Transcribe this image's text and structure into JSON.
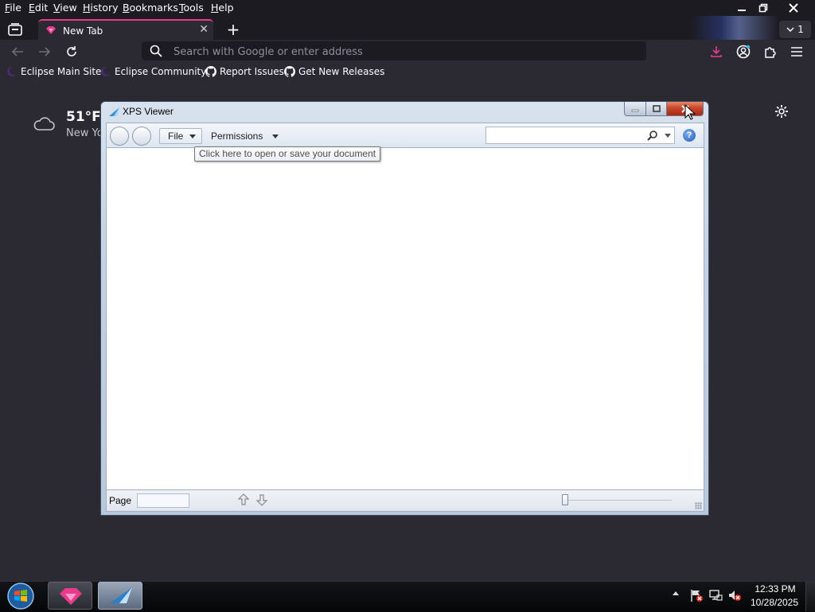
{
  "browser": {
    "menu": [
      "File",
      "Edit",
      "View",
      "History",
      "Bookmarks",
      "Tools",
      "Help"
    ],
    "tab": {
      "title": "New Tab"
    },
    "tab_count": "1",
    "urlbar": {
      "placeholder": "Search with Google or enter address"
    },
    "bookmarks": [
      "Eclipse Main Site",
      "Eclipse Community",
      "Report Issues",
      "Get New Releases"
    ],
    "weather": {
      "temp": "51°F",
      "location": "New Yo"
    },
    "accent_color": "#e93a8c"
  },
  "xps_viewer": {
    "title": "XPS Viewer",
    "toolbar": {
      "file": "File",
      "permissions": "Permissions",
      "search_placeholder": ""
    },
    "help": "?",
    "tooltip": "Click here to open or save your document",
    "status": {
      "page_label": "Page",
      "page_value": ""
    }
  },
  "taskbar": {
    "time": "12:33 PM",
    "date": "10/28/2025"
  }
}
